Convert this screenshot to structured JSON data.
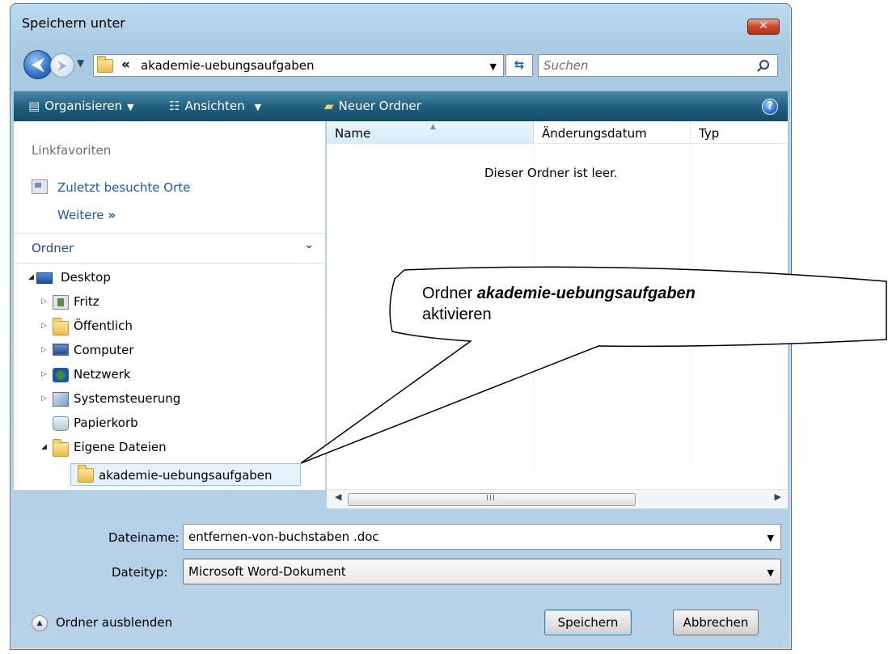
{
  "window": {
    "title": "Speichern unter",
    "close_glyph": "✕"
  },
  "address": {
    "back_glyph": "⮜",
    "forward_glyph": "⮞",
    "breadcrumb_chevron": "«",
    "path": "akademie-uebungsaufgaben",
    "search_placeholder": "Suchen"
  },
  "toolbar": {
    "organize": "Organisieren",
    "views": "Ansichten",
    "new_folder": "Neuer Ordner",
    "help": "?"
  },
  "left_pane": {
    "favorites_header": "Linkfavoriten",
    "recent_places": "Zuletzt besuchte Orte",
    "more": "Weitere",
    "more_glyph": "»",
    "folders_header": "Ordner",
    "tree": [
      {
        "label": "Desktop",
        "icon": "desktop-icon",
        "expanded": true
      },
      {
        "label": "Fritz",
        "icon": "user-folder-icon",
        "expanded": false
      },
      {
        "label": "Öffentlich",
        "icon": "folder-icon",
        "expanded": false
      },
      {
        "label": "Computer",
        "icon": "computer-icon",
        "expanded": false
      },
      {
        "label": "Netzwerk",
        "icon": "network-icon",
        "expanded": false
      },
      {
        "label": "Systemsteuerung",
        "icon": "control-panel-icon",
        "expanded": false
      },
      {
        "label": "Papierkorb",
        "icon": "recycle-bin-icon",
        "expanded": false
      },
      {
        "label": "Eigene Dateien",
        "icon": "folder-icon",
        "expanded": true
      },
      {
        "label": "akademie-uebungsaufgaben",
        "icon": "folder-icon",
        "selected": true
      }
    ]
  },
  "file_list": {
    "columns": [
      "Name",
      "Änderungsdatum",
      "Typ"
    ],
    "empty_message": "Dieser Ordner ist leer.",
    "scroll_grip": "III"
  },
  "form": {
    "filename_label": "Dateiname:",
    "filename_value": "entfernen-von-buchstaben .doc",
    "filetype_label": "Dateityp:",
    "filetype_value": "Microsoft Word-Dokument"
  },
  "footer": {
    "hide_folders": "Ordner ausblenden",
    "save": "Speichern",
    "cancel": "Abbrechen"
  },
  "callout": {
    "prefix": "Ordner ",
    "emphasis": "akademie-uebungsaufgaben",
    "suffix": "aktivieren"
  }
}
